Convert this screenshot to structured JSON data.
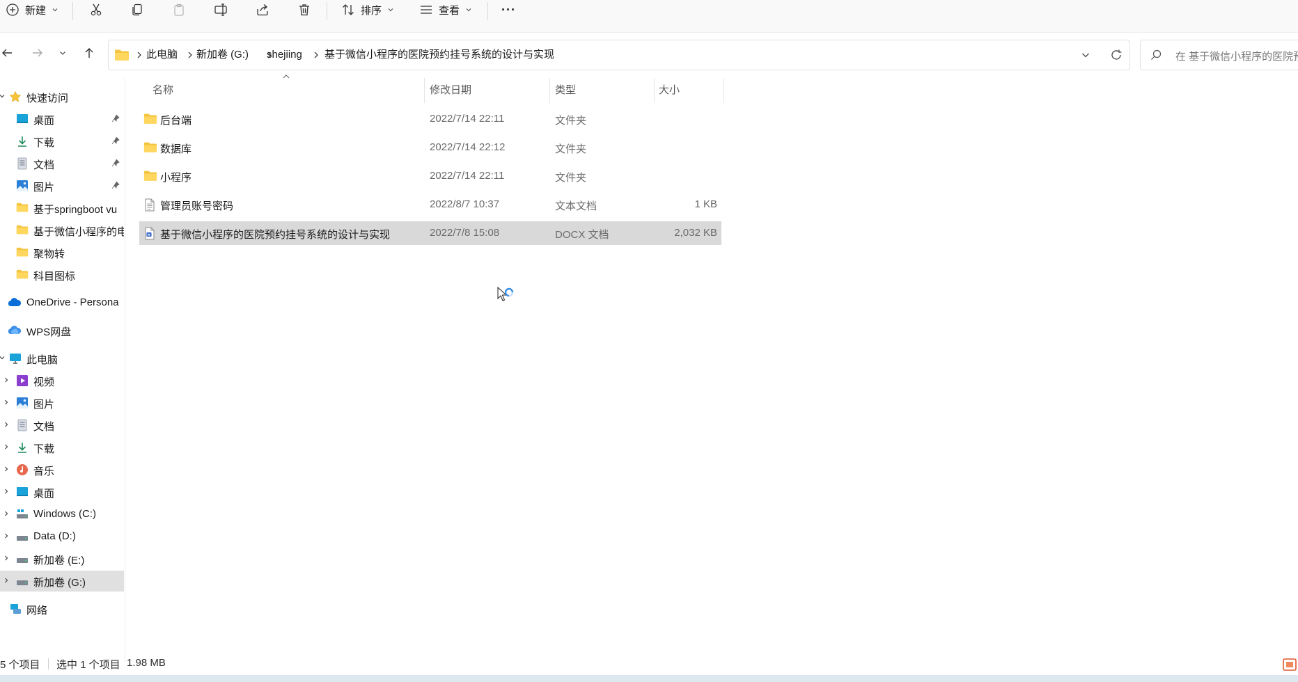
{
  "toolbar": {
    "new_label": "新建",
    "sort_label": "排序",
    "view_label": "查看",
    "more_label": "···"
  },
  "address": {
    "crumbs": [
      "此电脑",
      "新加卷 (G:)",
      "shejiing",
      "基于微信小程序的医院预约挂号系统的设计与实现"
    ]
  },
  "search": {
    "placeholder": "在 基于微信小程序的医院预"
  },
  "sidebar": {
    "quick_access": "快速访问",
    "quick_items": [
      {
        "label": "桌面",
        "icon": "desktop-icon",
        "pinned": true
      },
      {
        "label": "下载",
        "icon": "download-icon",
        "pinned": true
      },
      {
        "label": "文档",
        "icon": "document-icon",
        "pinned": true
      },
      {
        "label": "图片",
        "icon": "pictures-icon",
        "pinned": true
      },
      {
        "label": "基于springboot vu",
        "icon": "folder-icon",
        "pinned": false
      },
      {
        "label": "基于微信小程序的电",
        "icon": "folder-icon",
        "pinned": false
      },
      {
        "label": "聚物转",
        "icon": "folder-icon",
        "pinned": false
      },
      {
        "label": "科目图标",
        "icon": "folder-icon",
        "pinned": false
      }
    ],
    "onedrive": "OneDrive - Persona",
    "wps": "WPS网盘",
    "this_pc": "此电脑",
    "pc_items": [
      {
        "label": "视频",
        "icon": "videos-icon"
      },
      {
        "label": "图片",
        "icon": "pictures-icon"
      },
      {
        "label": "文档",
        "icon": "document-icon"
      },
      {
        "label": "下载",
        "icon": "download-icon"
      },
      {
        "label": "音乐",
        "icon": "music-icon"
      },
      {
        "label": "桌面",
        "icon": "desktop-icon"
      },
      {
        "label": "Windows (C:)",
        "icon": "drive-icon"
      },
      {
        "label": "Data (D:)",
        "icon": "drive-icon"
      },
      {
        "label": "新加卷 (E:)",
        "icon": "drive-icon"
      },
      {
        "label": "新加卷 (G:)",
        "icon": "drive-icon",
        "selected": true
      }
    ],
    "network": "网络"
  },
  "columns": {
    "name": "名称",
    "date": "修改日期",
    "type": "类型",
    "size": "大小"
  },
  "files": [
    {
      "name": "后台端",
      "date": "2022/7/14 22:11",
      "type": "文件夹",
      "size": "",
      "icon": "folder-icon"
    },
    {
      "name": "数据库",
      "date": "2022/7/14 22:12",
      "type": "文件夹",
      "size": "",
      "icon": "folder-icon"
    },
    {
      "name": "小程序",
      "date": "2022/7/14 22:11",
      "type": "文件夹",
      "size": "",
      "icon": "folder-icon"
    },
    {
      "name": "管理员账号密码",
      "date": "2022/8/7 10:37",
      "type": "文本文档",
      "size": "1 KB",
      "icon": "text-file-icon"
    },
    {
      "name": "基于微信小程序的医院预约挂号系统的设计与实现",
      "date": "2022/7/8 15:08",
      "type": "DOCX 文档",
      "size": "2,032 KB",
      "icon": "docx-file-icon",
      "selected": true
    }
  ],
  "status": {
    "count": "5 个项目",
    "selection": "选中 1 个项目",
    "selection_size": "1.98 MB"
  }
}
